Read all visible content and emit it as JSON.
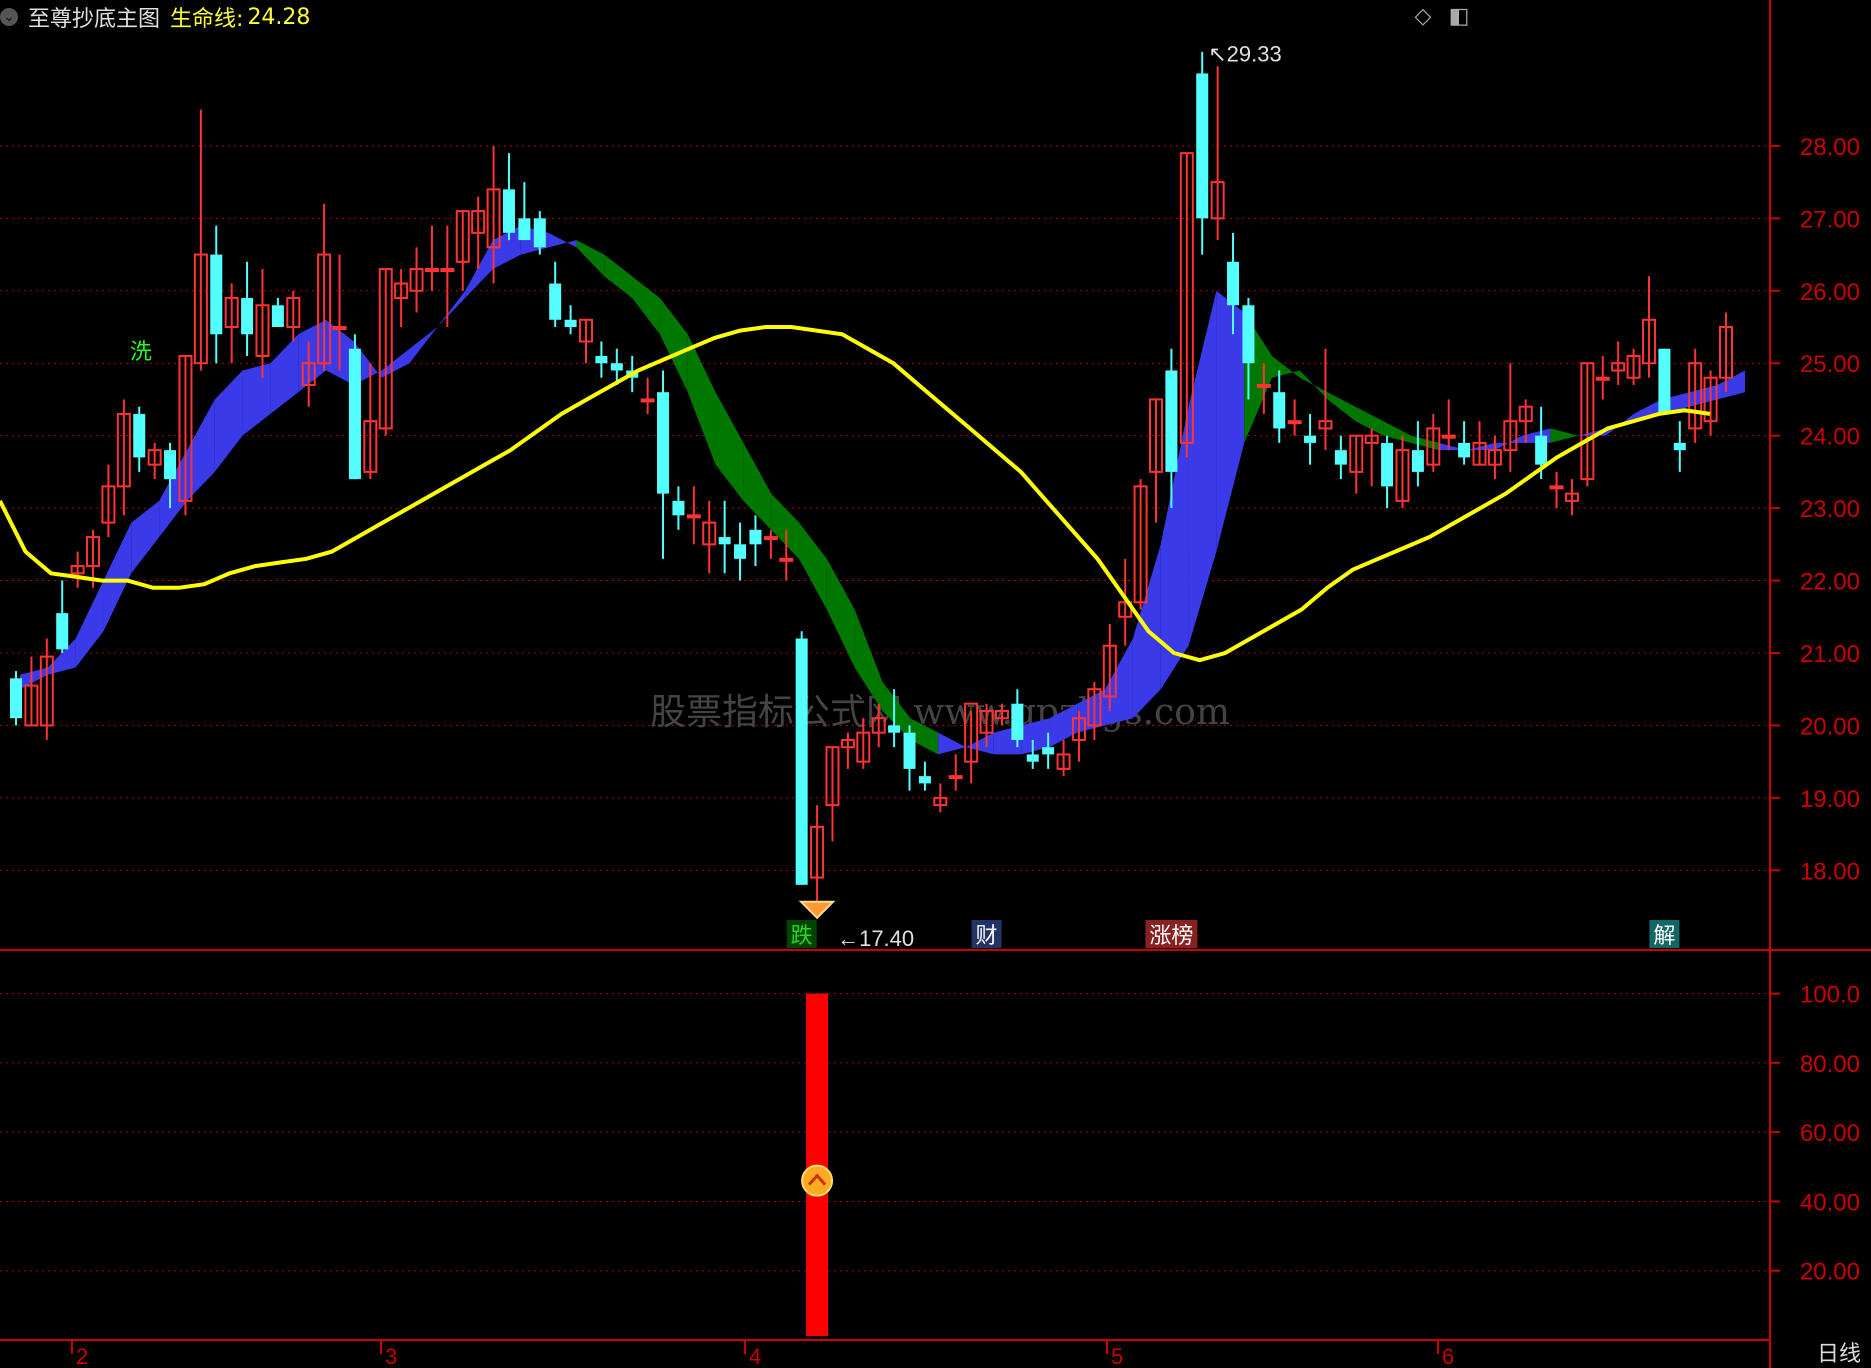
{
  "header": {
    "title": "至尊抄底主图",
    "lifeline_label": "生命线:",
    "lifeline_value": "24.28"
  },
  "period_label": "日线",
  "watermark": "股票指标公式网 www.gpzbgs.com",
  "colors": {
    "background": "#000000",
    "up_candle": "#ff3333",
    "down_candle": "#54ffff",
    "lifeline": "#ffff00",
    "band_up": "#3a3ae8",
    "band_down": "#007700",
    "axis": "#cc0000",
    "grid": "#aa0000"
  },
  "chart_data": [
    {
      "type": "candlestick",
      "title": "",
      "ylim": [
        16.9,
        29.6
      ],
      "y_ticks": [
        "28.00",
        "27.00",
        "26.00",
        "25.00",
        "24.00",
        "23.00",
        "22.00",
        "21.00",
        "20.00",
        "19.00",
        "18.00"
      ],
      "x_ticks": [
        "2",
        "3",
        "4",
        "5",
        "6"
      ],
      "ohlc": [
        [
          20.65,
          20.75,
          20.0,
          20.1
        ],
        [
          20.0,
          20.95,
          20.0,
          20.55
        ],
        [
          20.0,
          21.2,
          19.8,
          20.95
        ],
        [
          21.55,
          22.0,
          21.0,
          21.05
        ],
        [
          22.1,
          22.4,
          21.9,
          22.2
        ],
        [
          22.2,
          22.7,
          21.9,
          22.6
        ],
        [
          22.8,
          23.6,
          22.6,
          23.3
        ],
        [
          23.3,
          24.5,
          22.9,
          24.3
        ],
        [
          24.3,
          24.4,
          23.5,
          23.7
        ],
        [
          23.6,
          23.9,
          23.4,
          23.8
        ],
        [
          23.8,
          23.9,
          23.0,
          23.4
        ],
        [
          23.1,
          25.1,
          22.9,
          25.1
        ],
        [
          25.0,
          28.5,
          24.9,
          26.5
        ],
        [
          26.5,
          26.9,
          25.0,
          25.4
        ],
        [
          25.5,
          26.1,
          25.0,
          25.9
        ],
        [
          25.9,
          26.4,
          25.1,
          25.4
        ],
        [
          25.1,
          26.3,
          24.8,
          25.8
        ],
        [
          25.8,
          25.9,
          25.5,
          25.5
        ],
        [
          25.5,
          26.0,
          25.3,
          25.9
        ],
        [
          24.7,
          25.3,
          24.4,
          25.0
        ],
        [
          25.0,
          27.2,
          24.9,
          26.5
        ],
        [
          25.5,
          26.5,
          24.9,
          25.5
        ],
        [
          25.2,
          25.4,
          23.4,
          23.4
        ],
        [
          23.5,
          25.0,
          23.4,
          24.2
        ],
        [
          24.1,
          26.3,
          24.0,
          26.3
        ],
        [
          25.9,
          26.3,
          25.5,
          26.1
        ],
        [
          26.0,
          26.6,
          25.7,
          26.3
        ],
        [
          26.3,
          26.9,
          26.0,
          26.3
        ],
        [
          26.3,
          26.9,
          25.5,
          26.3
        ],
        [
          26.4,
          27.1,
          26.0,
          27.1
        ],
        [
          26.8,
          27.3,
          26.3,
          27.1
        ],
        [
          26.6,
          28.0,
          26.1,
          27.4
        ],
        [
          27.4,
          27.9,
          26.7,
          26.8
        ],
        [
          27.0,
          27.5,
          26.7,
          26.7
        ],
        [
          27.0,
          27.1,
          26.5,
          26.6
        ],
        [
          26.1,
          26.4,
          25.5,
          25.6
        ],
        [
          25.6,
          25.8,
          25.4,
          25.5
        ],
        [
          25.3,
          25.6,
          25.0,
          25.6
        ],
        [
          25.1,
          25.3,
          24.8,
          25.0
        ],
        [
          25.0,
          25.2,
          24.7,
          24.9
        ],
        [
          24.9,
          25.1,
          24.6,
          24.8
        ],
        [
          24.5,
          24.8,
          24.3,
          24.5
        ],
        [
          24.6,
          24.9,
          22.3,
          23.2
        ],
        [
          23.1,
          23.3,
          22.7,
          22.9
        ],
        [
          22.9,
          23.3,
          22.5,
          22.9
        ],
        [
          22.5,
          23.1,
          22.1,
          22.8
        ],
        [
          22.6,
          23.1,
          22.1,
          22.5
        ],
        [
          22.5,
          22.8,
          22.0,
          22.3
        ],
        [
          22.7,
          22.9,
          22.2,
          22.5
        ],
        [
          22.6,
          22.7,
          22.3,
          22.6
        ],
        [
          22.3,
          22.7,
          22.0,
          22.3
        ],
        [
          21.2,
          21.3,
          17.8,
          17.8
        ],
        [
          17.9,
          18.9,
          17.4,
          18.6
        ],
        [
          18.9,
          19.7,
          18.4,
          19.7
        ],
        [
          19.7,
          19.9,
          19.4,
          19.8
        ],
        [
          19.5,
          20.1,
          19.4,
          19.9
        ],
        [
          19.9,
          20.3,
          19.7,
          20.1
        ],
        [
          20.0,
          20.5,
          19.7,
          19.9
        ],
        [
          19.9,
          20.0,
          19.1,
          19.4
        ],
        [
          19.3,
          19.5,
          19.1,
          19.2
        ],
        [
          18.9,
          19.2,
          18.8,
          19.0
        ],
        [
          19.3,
          19.6,
          19.1,
          19.3
        ],
        [
          19.5,
          20.2,
          19.2,
          20.3
        ],
        [
          19.9,
          20.3,
          19.7,
          20.2
        ],
        [
          20.1,
          20.3,
          20.0,
          20.2
        ],
        [
          20.3,
          20.5,
          19.7,
          19.8
        ],
        [
          19.6,
          19.8,
          19.4,
          19.5
        ],
        [
          19.7,
          19.9,
          19.4,
          19.6
        ],
        [
          19.4,
          19.8,
          19.3,
          19.6
        ],
        [
          19.8,
          20.2,
          19.5,
          20.1
        ],
        [
          20.0,
          20.6,
          19.8,
          20.5
        ],
        [
          20.4,
          21.4,
          20.2,
          21.1
        ],
        [
          21.5,
          22.3,
          21.1,
          21.7
        ],
        [
          21.7,
          23.4,
          21.6,
          23.3
        ],
        [
          23.5,
          24.5,
          22.8,
          24.5
        ],
        [
          24.9,
          25.2,
          23.0,
          23.5
        ],
        [
          23.9,
          27.9,
          23.7,
          27.9
        ],
        [
          29.0,
          29.3,
          26.5,
          27.0
        ],
        [
          27.0,
          29.1,
          26.7,
          27.5
        ],
        [
          26.4,
          26.8,
          25.4,
          25.8
        ],
        [
          25.8,
          25.9,
          24.5,
          25.0
        ],
        [
          24.7,
          25.0,
          24.3,
          24.7
        ],
        [
          24.6,
          24.9,
          23.9,
          24.1
        ],
        [
          24.2,
          24.5,
          24.0,
          24.2
        ],
        [
          24.0,
          24.3,
          23.6,
          23.9
        ],
        [
          24.1,
          25.2,
          23.8,
          24.2
        ],
        [
          23.8,
          24.0,
          23.4,
          23.6
        ],
        [
          23.5,
          24.0,
          23.2,
          24.0
        ],
        [
          23.9,
          24.1,
          23.3,
          24.0
        ],
        [
          23.9,
          24.0,
          23.0,
          23.3
        ],
        [
          23.1,
          24.0,
          23.0,
          23.8
        ],
        [
          23.8,
          24.2,
          23.3,
          23.5
        ],
        [
          23.6,
          24.3,
          23.5,
          24.1
        ],
        [
          24.0,
          24.5,
          23.8,
          24.0
        ],
        [
          23.9,
          24.2,
          23.6,
          23.7
        ],
        [
          23.6,
          24.2,
          23.6,
          23.9
        ],
        [
          23.6,
          24.0,
          23.4,
          23.8
        ],
        [
          23.8,
          25.0,
          23.5,
          24.2
        ],
        [
          24.2,
          24.5,
          23.9,
          24.4
        ],
        [
          24.0,
          24.4,
          23.4,
          23.6
        ],
        [
          23.3,
          23.5,
          23.0,
          23.3
        ],
        [
          23.1,
          23.4,
          22.9,
          23.2
        ],
        [
          23.4,
          25.0,
          23.3,
          25.0
        ],
        [
          24.8,
          25.1,
          24.5,
          24.8
        ],
        [
          24.9,
          25.3,
          24.7,
          25.0
        ],
        [
          24.8,
          25.2,
          24.7,
          25.1
        ],
        [
          25.0,
          26.2,
          24.8,
          25.6
        ],
        [
          25.2,
          25.2,
          24.4,
          24.3
        ],
        [
          23.9,
          24.2,
          23.5,
          23.8
        ],
        [
          24.1,
          25.2,
          23.9,
          25.0
        ],
        [
          24.2,
          24.9,
          24.0,
          24.8
        ],
        [
          24.8,
          25.7,
          24.6,
          25.5
        ]
      ],
      "lifeline": [
        23.1,
        22.4,
        22.1,
        22.05,
        22.0,
        22.0,
        21.9,
        21.9,
        21.95,
        22.1,
        22.2,
        22.25,
        22.3,
        22.4,
        22.6,
        22.8,
        23.0,
        23.2,
        23.4,
        23.6,
        23.8,
        24.05,
        24.3,
        24.5,
        24.7,
        24.9,
        25.05,
        25.2,
        25.35,
        25.45,
        25.5,
        25.5,
        25.45,
        25.4,
        25.2,
        25.0,
        24.7,
        24.4,
        24.1,
        23.8,
        23.5,
        23.1,
        22.7,
        22.3,
        21.8,
        21.3,
        21.0,
        20.9,
        21.0,
        21.2,
        21.4,
        21.6,
        21.9,
        22.15,
        22.3,
        22.45,
        22.6,
        22.8,
        23.0,
        23.2,
        23.45,
        23.7,
        23.9,
        24.1,
        24.2,
        24.3,
        24.35,
        24.3
      ],
      "band_top": [
        20.7,
        20.8,
        21.2,
        22.0,
        22.8,
        23.1,
        23.8,
        24.5,
        24.9,
        25.0,
        25.4,
        25.6,
        25.3,
        24.8,
        25.0,
        25.5,
        26.0,
        26.7,
        26.9,
        26.8,
        26.6,
        26.2,
        25.9,
        25.4,
        24.6,
        23.6,
        23.1,
        22.7,
        22.3,
        21.6,
        20.8,
        20.2,
        19.8,
        19.6,
        19.7,
        19.9,
        20.0,
        20.1,
        20.3,
        20.5,
        21.2,
        22.5,
        24.4,
        26.0,
        25.7,
        25.1,
        24.8,
        24.6,
        24.4,
        24.2,
        24.0,
        23.9,
        23.8,
        23.8,
        24.0,
        24.1,
        24.0,
        24.0,
        24.3,
        24.5,
        24.6,
        24.7,
        24.9
      ],
      "band_bottom": [
        20.5,
        20.7,
        20.8,
        21.3,
        22.1,
        22.6,
        23.1,
        23.5,
        24.0,
        24.3,
        24.6,
        24.9,
        24.7,
        24.9,
        25.2,
        25.5,
        25.9,
        26.3,
        26.5,
        26.6,
        26.7,
        26.5,
        26.2,
        25.9,
        25.4,
        24.6,
        23.9,
        23.2,
        22.8,
        22.3,
        21.6,
        20.6,
        20.1,
        19.9,
        19.7,
        19.6,
        19.6,
        19.7,
        19.9,
        20.0,
        20.1,
        20.5,
        21.1,
        22.4,
        23.9,
        24.8,
        24.9,
        24.5,
        24.2,
        24.0,
        23.9,
        23.8,
        23.8,
        23.9,
        23.9,
        23.9,
        24.0,
        24.1,
        24.2,
        24.3,
        24.4,
        24.5,
        24.6
      ],
      "annotations": [
        {
          "text": "29.33",
          "value": 29.33
        },
        {
          "text": "17.40",
          "value": 17.4
        },
        {
          "text": "洗",
          "color": "#22ff22"
        },
        {
          "text": "跌",
          "color": "#22dd22",
          "bg": "#004400"
        },
        {
          "text": "财",
          "color": "#ffffff",
          "bg": "#223366"
        },
        {
          "text": "涨榜",
          "color": "#ffffff",
          "bg": "#882222"
        },
        {
          "text": "解",
          "color": "#ffffff",
          "bg": "#116666"
        }
      ]
    },
    {
      "type": "bar",
      "title": "",
      "ylim": [
        0,
        112
      ],
      "y_ticks": [
        "100.0",
        "80.00",
        "60.00",
        "40.00",
        "20.00"
      ],
      "bars": [
        {
          "value": 100,
          "color": "#ff0000",
          "marker_value": 46
        }
      ]
    }
  ]
}
